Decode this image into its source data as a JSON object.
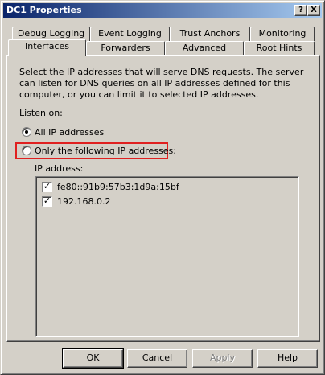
{
  "window": {
    "title": "DC1 Properties",
    "help_label": "?",
    "close_label": "X"
  },
  "tabs": {
    "row_back": [
      "Debug Logging",
      "Event Logging",
      "Trust Anchors",
      "Monitoring"
    ],
    "row_front": [
      "Interfaces",
      "Forwarders",
      "Advanced",
      "Root Hints"
    ],
    "active": "Interfaces"
  },
  "interfaces": {
    "description": "Select the IP addresses that will serve DNS requests. The server can listen for DNS queries on all IP addresses defined for this computer, or you can limit it to selected IP addresses.",
    "listen_on_label": "Listen on:",
    "option_all": "All IP addresses",
    "option_only": "Only the following IP addresses:",
    "selected_option": "All IP addresses",
    "ip_address_label": "IP address:",
    "ip_addresses": [
      {
        "address": "fe80::91b9:57b3:1d9a:15bf",
        "checked": true
      },
      {
        "address": "192.168.0.2",
        "checked": true
      }
    ]
  },
  "buttons": {
    "ok": "OK",
    "cancel": "Cancel",
    "apply": "Apply",
    "help": "Help"
  },
  "colors": {
    "title_gradient_start": "#0a246a",
    "title_gradient_end": "#a6caf0",
    "highlight_box": "#e02020",
    "window_face": "#d4d0c8"
  }
}
